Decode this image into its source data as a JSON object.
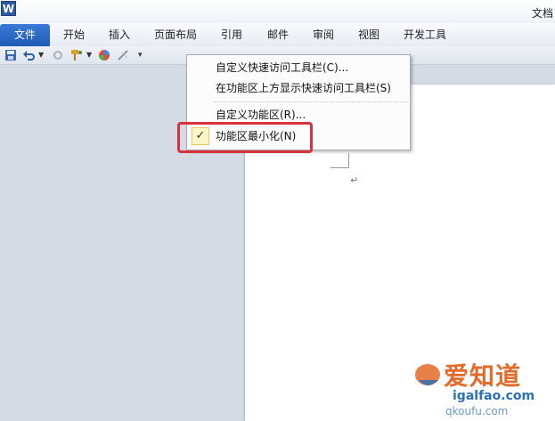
{
  "app": {
    "logo_text": "W",
    "doc_title": "文档"
  },
  "ribbon": {
    "file_tab": "文件",
    "tabs": [
      "开始",
      "插入",
      "页面布局",
      "引用",
      "邮件",
      "审阅",
      "视图",
      "开发工具"
    ]
  },
  "qat": {
    "icons": [
      "save-icon",
      "undo-icon",
      "undo-dropdown-icon",
      "redo-icon",
      "format-painter-icon",
      "format-painter-dropdown-icon",
      "color-circle-icon",
      "pen-icon",
      "customize-dropdown-icon"
    ]
  },
  "menu": {
    "items": [
      {
        "label": "自定义快速访问工具栏(C)..."
      },
      {
        "label": "在功能区上方显示快速访问工具栏(S)"
      },
      {
        "label": "自定义功能区(R)..."
      },
      {
        "label": "功能区最小化(N)",
        "checked": true
      }
    ]
  },
  "document": {
    "paragraph_mark": "↵"
  },
  "watermark": {
    "main": "爱知道",
    "url": "igalfao.com",
    "url2": "qkoufu.com"
  },
  "colors": {
    "accent": "#1f5bb5",
    "highlight": "#d8323c",
    "check_bg": "#fff6c8"
  }
}
